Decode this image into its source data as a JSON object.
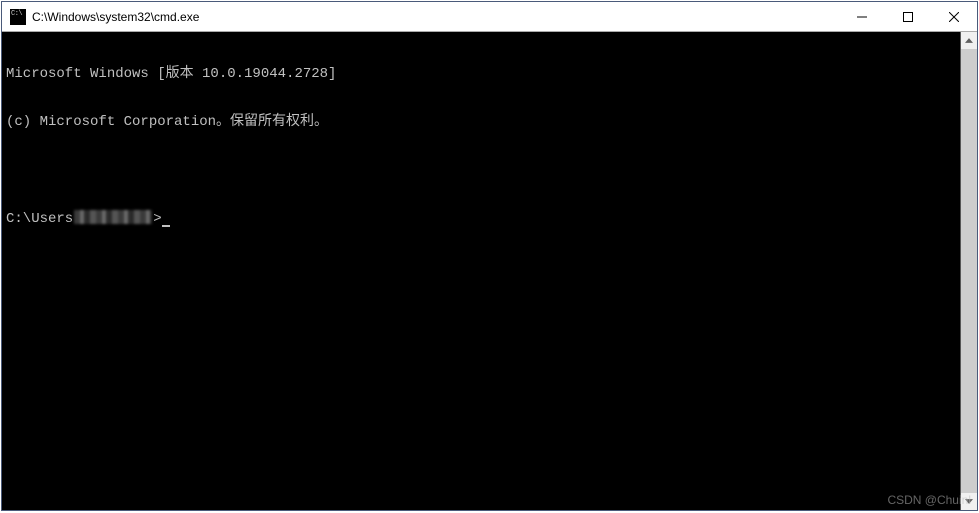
{
  "window": {
    "title": "C:\\Windows\\system32\\cmd.exe"
  },
  "terminal": {
    "line1": "Microsoft Windows [版本 10.0.19044.2728]",
    "line2": "(c) Microsoft Corporation。保留所有权利。",
    "blank": "",
    "prompt_left": "C:\\Users",
    "prompt_right": ">"
  },
  "watermark": "CSDN @Chuinl"
}
